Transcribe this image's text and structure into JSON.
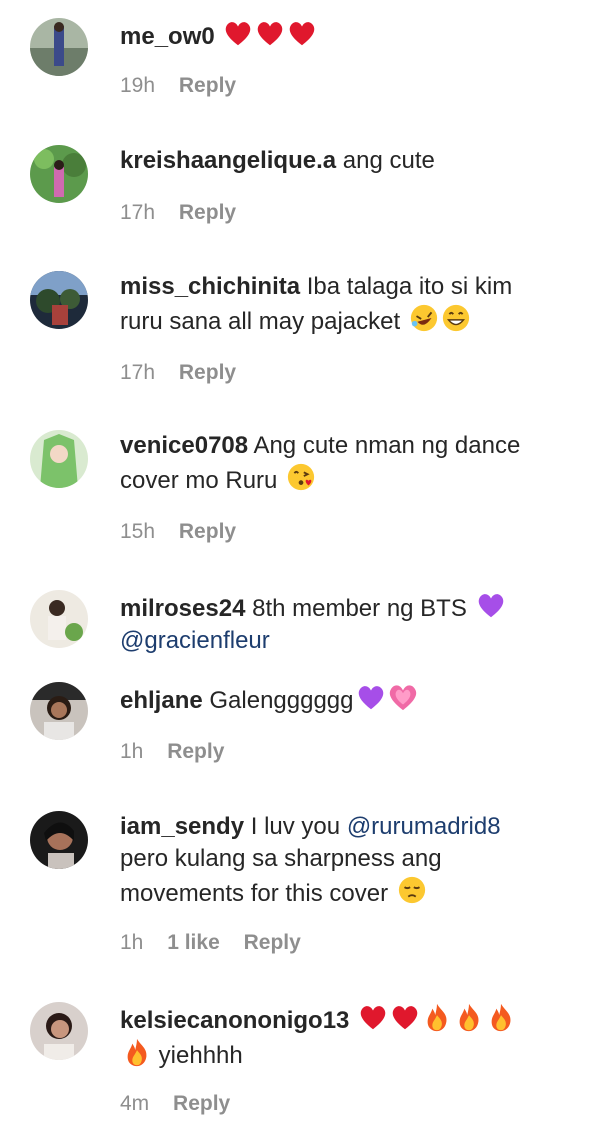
{
  "comments": [
    {
      "username": "me_ow0",
      "text": "",
      "emoji": [
        "heart-icon",
        "heart-icon",
        "heart-icon"
      ],
      "time": "19h",
      "reply": "Reply"
    },
    {
      "username": "kreishaangelique.a",
      "text": "ang cute",
      "time": "17h",
      "reply": "Reply"
    },
    {
      "username": "miss_chichinita",
      "text1": "Iba talaga ito si kim",
      "text2": "ruru sana all may pajacket",
      "emoji": [
        "rofl-icon",
        "grin-icon"
      ],
      "time": "17h",
      "reply": "Reply"
    },
    {
      "username": "venice0708",
      "text1": "Ang cute nman ng dance",
      "text2": "cover mo Ruru",
      "emoji": [
        "kiss-icon"
      ],
      "time": "15h",
      "reply": "Reply"
    },
    {
      "username": "milroses24",
      "text1": "8th member ng BTS",
      "mention": "@gracienfleur",
      "emoji": [
        "purple-heart-icon"
      ]
    },
    {
      "username": "ehljane",
      "text": "Galengggggg",
      "emoji": [
        "purple-heart-icon",
        "growing-heart-icon"
      ],
      "time": "1h",
      "reply": "Reply"
    },
    {
      "username": "iam_sendy",
      "text1": "I luv you",
      "mention": "@rurumadrid8",
      "text2": "pero kulang sa sharpness ang",
      "text3": "movements for this cover",
      "emoji": [
        "pensive-icon"
      ],
      "time": "1h",
      "likes": "1 like",
      "reply": "Reply"
    },
    {
      "username": "kelsiecanononigo13",
      "text": "yiehhhh",
      "emoji": [
        "heart-icon",
        "heart-icon",
        "fire-icon",
        "fire-icon",
        "fire-icon",
        "fire-icon"
      ],
      "time": "4m",
      "reply": "Reply"
    }
  ]
}
